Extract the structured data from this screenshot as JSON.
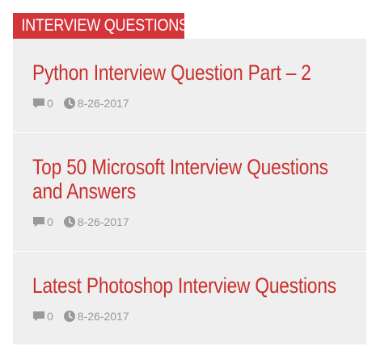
{
  "widget": {
    "title": "INTERVIEW QUESTIONS",
    "colors": {
      "accent": "#d3353b",
      "post_title": "#c9302c",
      "meta_text": "#999999",
      "panel_bg": "#efefef"
    }
  },
  "posts": [
    {
      "title": "Python Interview Question Part – 2",
      "comments": "0",
      "date": "8-26-2017",
      "comment_icon": "comment-icon",
      "date_icon": "clock-icon"
    },
    {
      "title": "Top 50 Microsoft Interview Questions and Answers",
      "comments": "0",
      "date": "8-26-2017",
      "comment_icon": "comment-icon",
      "date_icon": "clock-icon"
    },
    {
      "title": "Latest Photoshop Interview Questions",
      "comments": "0",
      "date": "8-26-2017",
      "comment_icon": "comment-icon",
      "date_icon": "clock-icon"
    }
  ]
}
